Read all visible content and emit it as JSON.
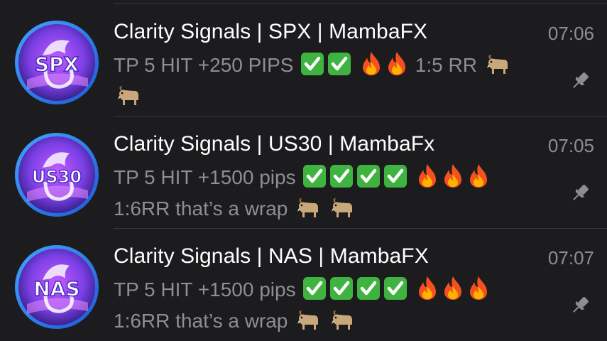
{
  "chats": [
    {
      "title": "Clarity Signals | SPX | MambaFX",
      "time": "07:06",
      "preview_before": "TP 5 HIT +250 PIPS",
      "checks": 2,
      "fires": 2,
      "preview_after": "1:5 RR",
      "goats_inline": 1,
      "goats_line2": 1,
      "preview_line2": "",
      "avatar_label": "SPX",
      "pinned": true
    },
    {
      "title": "Clarity Signals | US30 | MambaFx",
      "time": "07:05",
      "preview_before": "TP 5 HIT +1500 pips",
      "checks": 4,
      "fires": 3,
      "preview_after": "",
      "goats_inline": 0,
      "preview_line2": "1:6RR that’s a wrap",
      "goats_line2": 2,
      "avatar_label": "US30",
      "pinned": true
    },
    {
      "title": "Clarity Signals | NAS | MambaFX",
      "time": "07:07",
      "preview_before": "TP 5 HIT +1500 pips",
      "checks": 4,
      "fires": 3,
      "preview_after": "",
      "goats_inline": 0,
      "preview_line2": "1:6RR that’s a wrap",
      "goats_line2": 2,
      "avatar_label": "NAS",
      "pinned": true
    }
  ],
  "icons": {
    "check": "check-mark-button-icon",
    "fire": "fire-icon",
    "goat": "goat-icon",
    "pin": "pin-icon"
  },
  "colors": {
    "background": "#1c1c1e",
    "title": "#ffffff",
    "secondary": "#8e8e93",
    "check_green": "#3fb33f",
    "avatar_purple": "#7b3fe4",
    "avatar_blue": "#2f6fe0"
  }
}
